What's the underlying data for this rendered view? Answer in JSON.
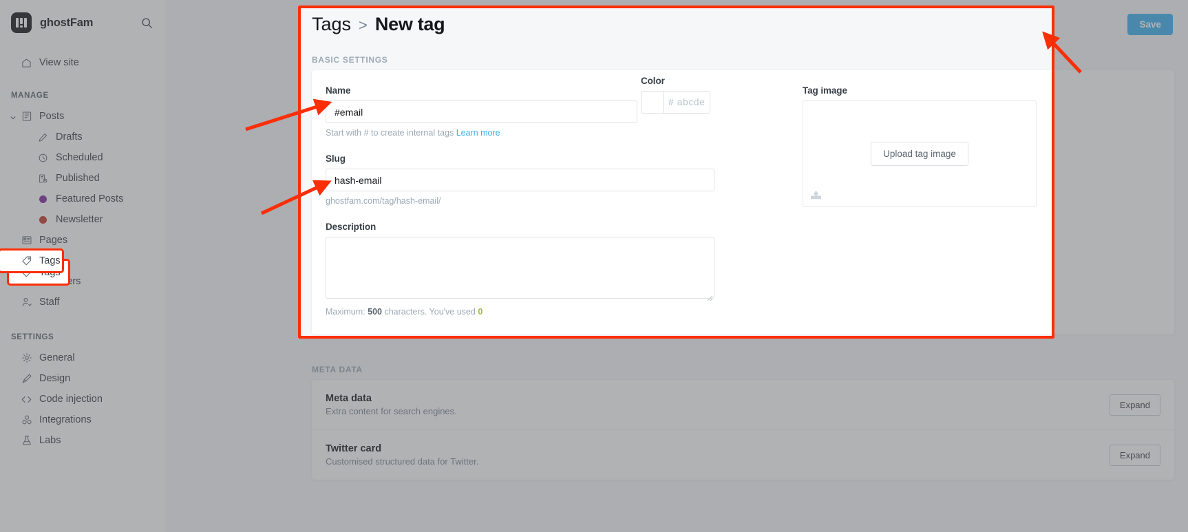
{
  "sidebar": {
    "site_title": "ghostFam",
    "search_icon": "search-icon",
    "view_site": "View site",
    "sections": [
      {
        "label": "MANAGE",
        "items": [
          {
            "label": "Posts",
            "icon": "posts-icon",
            "expandable": true
          },
          {
            "label": "Drafts",
            "icon": "pencil-icon",
            "sub": true
          },
          {
            "label": "Scheduled",
            "icon": "clock-icon",
            "sub": true
          },
          {
            "label": "Published",
            "icon": "published-icon",
            "sub": true
          },
          {
            "label": "Featured Posts",
            "icon": "dot-icon",
            "sub": true,
            "color": "#7d2a9b"
          },
          {
            "label": "Newsletter",
            "icon": "dot-icon",
            "sub": true,
            "color": "#c0392b"
          },
          {
            "label": "Pages",
            "icon": "pages-icon"
          },
          {
            "label": "Tags",
            "icon": "tag-icon",
            "highlighted": true
          },
          {
            "label": "Members",
            "icon": "members-icon"
          },
          {
            "label": "Staff",
            "icon": "staff-icon"
          }
        ]
      },
      {
        "label": "SETTINGS",
        "items": [
          {
            "label": "General",
            "icon": "gear-icon"
          },
          {
            "label": "Design",
            "icon": "brush-icon"
          },
          {
            "label": "Code injection",
            "icon": "code-icon"
          },
          {
            "label": "Integrations",
            "icon": "integrations-icon"
          },
          {
            "label": "Labs",
            "icon": "flask-icon"
          }
        ]
      }
    ]
  },
  "header": {
    "breadcrumb_parent": "Tags",
    "breadcrumb_separator": ">",
    "breadcrumb_current": "New tag",
    "save_label": "Save"
  },
  "basic_settings": {
    "section_label": "BASIC SETTINGS",
    "name_label": "Name",
    "name_value": "#email",
    "name_helper_text": "Start with # to create internal tags",
    "name_helper_link": "Learn more",
    "color_label": "Color",
    "color_placeholder": "# abcdef",
    "color_value": "",
    "slug_label": "Slug",
    "slug_value": "hash-email",
    "slug_url": "ghostfam.com/tag/hash-email/",
    "description_label": "Description",
    "description_value": "",
    "counter_prefix": "Maximum:",
    "counter_max": "500",
    "counter_middle": "characters. You've used",
    "counter_used": "0",
    "tag_image_label": "Tag image",
    "upload_label": "Upload tag image"
  },
  "meta_data": {
    "section_label": "META DATA",
    "rows": [
      {
        "title": "Meta data",
        "subtitle": "Extra content for search engines.",
        "action": "Expand"
      },
      {
        "title": "Twitter card",
        "subtitle": "Customised structured data for Twitter.",
        "action": "Expand"
      }
    ]
  },
  "colors": {
    "accent": "#3eb0ef",
    "annotation": "#fb2e06",
    "counter_used": "#9fbb3a",
    "featured_dot": "#7d2a9b",
    "newsletter_dot": "#c0392b"
  }
}
